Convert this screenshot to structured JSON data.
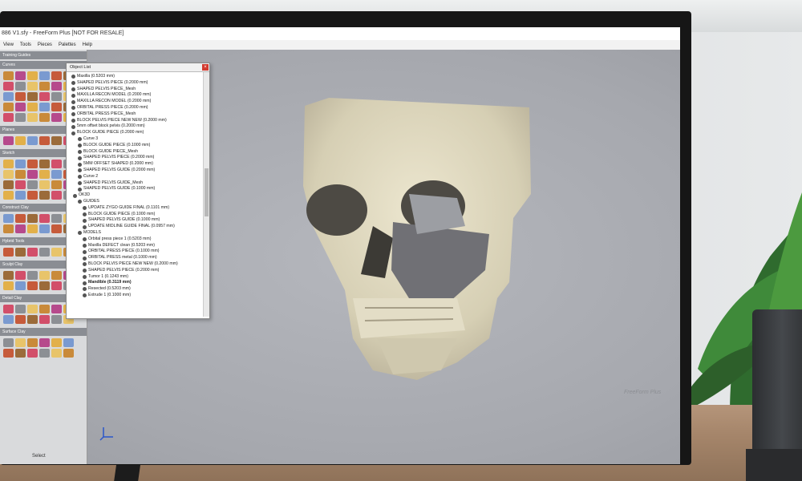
{
  "window": {
    "title": "886 V1.sfy - FreeForm Plus [NOT FOR RESALE]",
    "menus": [
      "View",
      "Tools",
      "Pieces",
      "Palettes",
      "Help"
    ]
  },
  "palette": {
    "title": "Training Guides",
    "sections": [
      "Curves",
      "Planes",
      "Sketch",
      "Construct Clay",
      "Hybrid Tools",
      "Sculpt Clay",
      "Detail Clay",
      "Surface Clay"
    ],
    "status": "Select"
  },
  "object_list": {
    "title": "Object List",
    "items": [
      {
        "label": "Maxilla (0.5203 mm)",
        "bold": false
      },
      {
        "label": "SHAPED PELVIS PIECE (0.2000 mm)",
        "bold": false
      },
      {
        "label": "SHAPED PELVIS PIECE_Mesh",
        "bold": false
      },
      {
        "label": "MAXILLA RECON MODEL (0.2000 mm)",
        "bold": false
      },
      {
        "label": "MAXILLA RECON MODEL (0.2000 mm)",
        "bold": false
      },
      {
        "label": "ORBITAL PRESS PIECE (0.2000 mm)",
        "bold": false
      },
      {
        "label": "ORBITAL PRESS PIECE_Mesh",
        "bold": false
      },
      {
        "label": "BLOCK PELVIS PIECE NEW NEW (0.2000 mm)",
        "bold": false
      },
      {
        "label": "5mm offset block pelvis (0.2000 mm)",
        "bold": false
      },
      {
        "label": "BLOCK GUIDE PIECE (0.2000 mm)",
        "bold": false
      },
      {
        "label": "Curve 3",
        "bold": false
      },
      {
        "label": "BLOCK GUIDE PIECE (0.1000 mm)",
        "bold": false
      },
      {
        "label": "BLOCK GUIDE PIECE_Mesh",
        "bold": false
      },
      {
        "label": "SHAPED PELVIS PIECE (0.2000 mm)",
        "bold": false
      },
      {
        "label": "5MM OFFSET SHAPED (0.2000 mm)",
        "bold": false
      },
      {
        "label": "SHAPED PELVIS GUIDE (0.2000 mm)",
        "bold": false
      },
      {
        "label": "Curve 2",
        "bold": false
      },
      {
        "label": "SHAPED PELVIS GUIDE_Mesh",
        "bold": false
      },
      {
        "label": "SHAPED PELVIS GUIDE (0.1000 mm)",
        "bold": false
      },
      {
        "label": "OK3D",
        "bold": false
      },
      {
        "label": "GUIDES",
        "bold": false
      },
      {
        "label": "UPDATE ZYGO GUIDE FINAL (0.1101 mm)",
        "bold": false
      },
      {
        "label": "BLOCK GUIDE PIECE (0.1000 mm)",
        "bold": false
      },
      {
        "label": "SHAPED PELVIS GUIDE (0.1000 mm)",
        "bold": false
      },
      {
        "label": "UPDATE MIDLINE GUIDE FINAL (0.0957 mm)",
        "bold": false
      },
      {
        "label": "MODELS",
        "bold": false
      },
      {
        "label": "Orbital press piece 1 (0.5203 mm)",
        "bold": false
      },
      {
        "label": "Maxilla DEFECT clean (0.5203 mm)",
        "bold": false
      },
      {
        "label": "ORBITAL PRESS PIECE (0.1000 mm)",
        "bold": false
      },
      {
        "label": "ORBITAL PRESS metal (0.1000 mm)",
        "bold": false
      },
      {
        "label": "BLOCK PELVIS PIECE NEW NEW (0.2000 mm)",
        "bold": false
      },
      {
        "label": "SHAPED PELVIS PIECE (0.2000 mm)",
        "bold": false
      },
      {
        "label": "Tumor 1 (0.1243 mm)",
        "bold": false
      },
      {
        "label": "Mandible (0.3119 mm)",
        "bold": true
      },
      {
        "label": "Resected (0.5203 mm)",
        "bold": false
      },
      {
        "label": "Extrude 1 (0.1000 mm)",
        "bold": false
      }
    ]
  },
  "viewport": {
    "brand": "FreeForm Plus",
    "background": "#a9abb1"
  },
  "colors": {
    "bone": "#ddd6bd",
    "implant": "#6f6f73"
  }
}
